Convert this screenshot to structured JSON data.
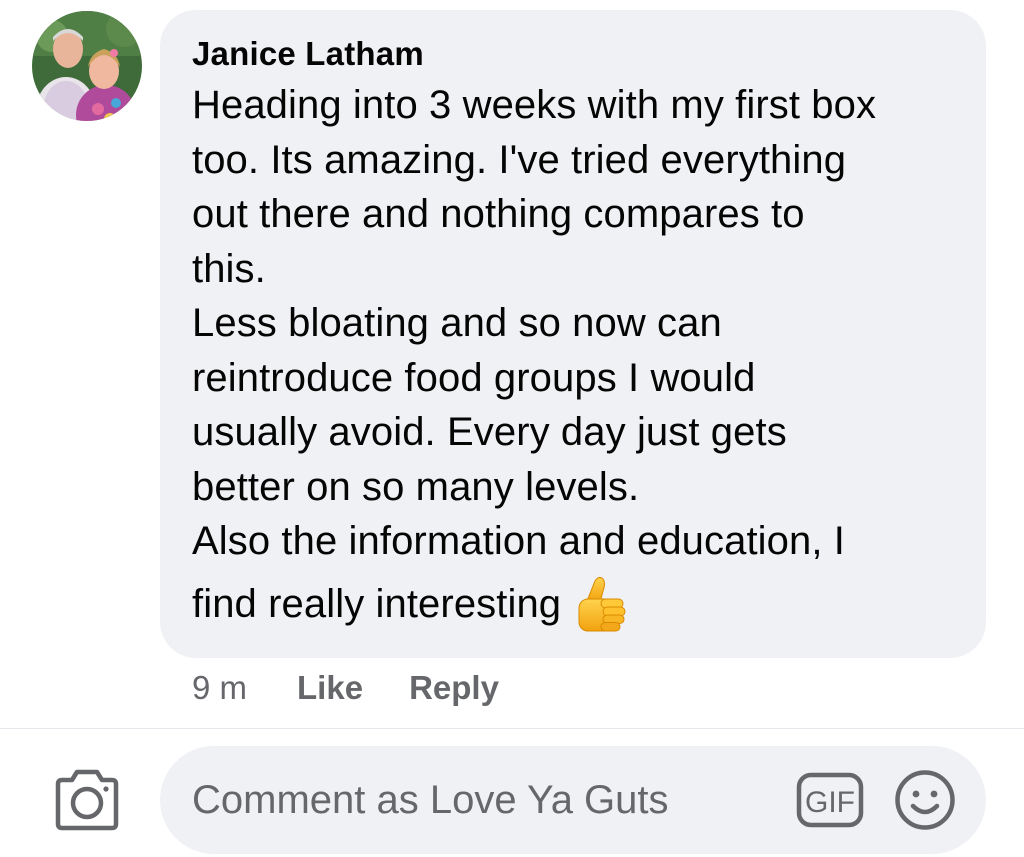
{
  "comment": {
    "author": "Janice Latham",
    "text": "Heading into 3 weeks with my first box\ntoo. Its amazing. I've tried everything\nout there and nothing compares to\nthis.\nLess bloating and so now can\nreintroduce food groups I would\nusually avoid. Every day just gets\nbetter on so many levels.\nAlso the information and education, I",
    "text_last_line": "find really interesting",
    "emoji": "thumbs-up",
    "time": "9 m",
    "like_label": "Like",
    "reply_label": "Reply"
  },
  "composer": {
    "placeholder": "Comment as Love Ya Guts",
    "gif_label": "GIF"
  },
  "colors": {
    "bubble_bg": "#f0f1f4",
    "secondary_text": "#65676b",
    "icon": "#65676b"
  }
}
